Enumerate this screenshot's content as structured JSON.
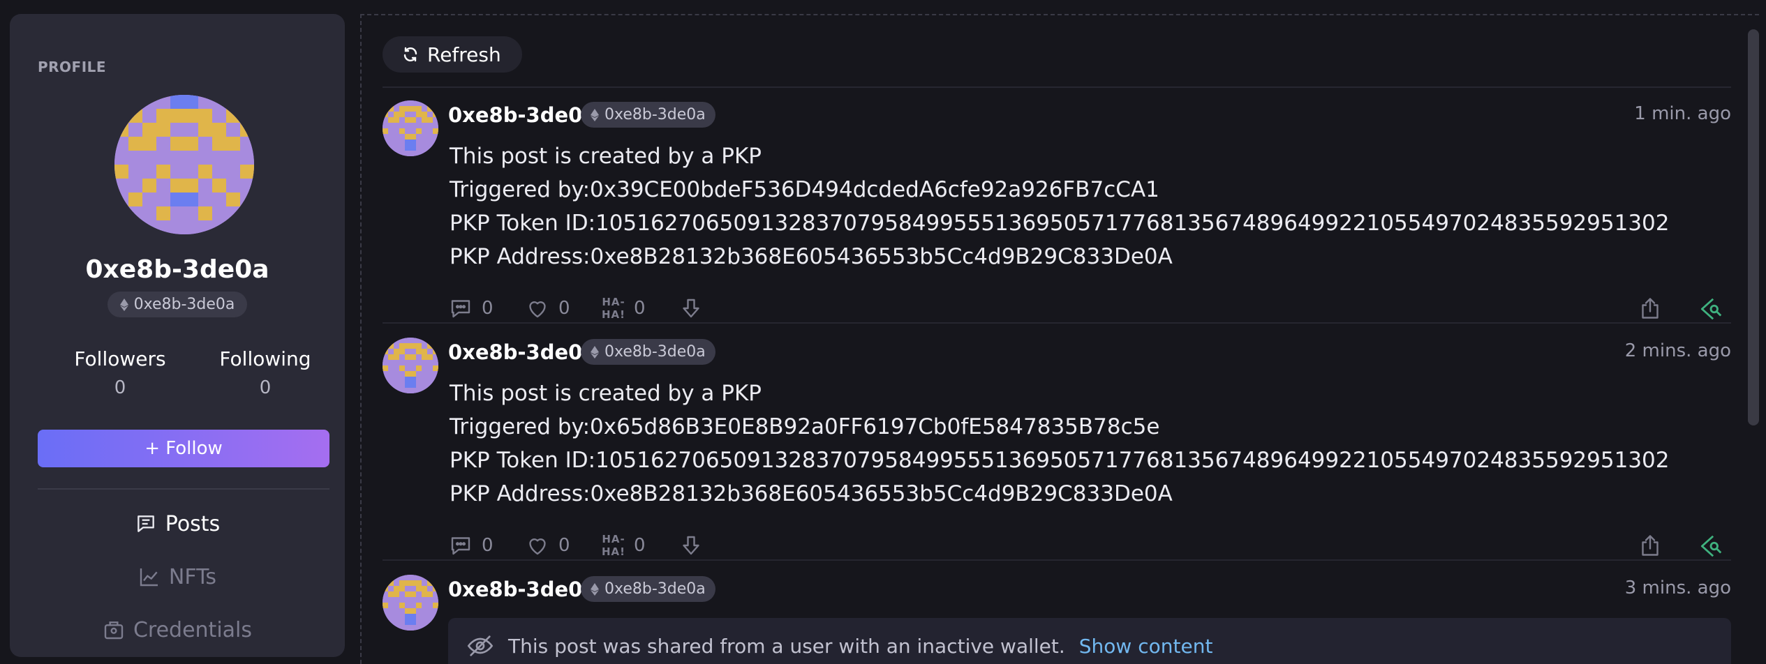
{
  "sidebar": {
    "section_label": "PROFILE",
    "name": "0xe8b-3de0a",
    "address_short": "0xe8b-3de0a",
    "followers_label": "Followers",
    "followers_count": "0",
    "following_label": "Following",
    "following_count": "0",
    "follow_label": "+ Follow",
    "nav": [
      {
        "label": "Posts",
        "icon": "posts-icon",
        "active": true
      },
      {
        "label": "NFTs",
        "icon": "nft-chart-icon",
        "active": false
      },
      {
        "label": "Credentials",
        "icon": "credentials-icon",
        "active": false
      }
    ]
  },
  "main": {
    "refresh_label": "Refresh",
    "posts": [
      {
        "author": "0xe8b-3de0a",
        "address_short": "0xe8b-3de0a",
        "time": "1 min. ago",
        "lines": [
          "This post is created by a PKP",
          "Triggered by:0x39CE00bdeF536D494dcdedA6cfe92a926FB7cCA1",
          "PKP Token ID:105162706509132837079584995551369505717768135674896499221055497024835592951302",
          "PKP Address:0xe8B28132b368E605436553b5Cc4d9B29C833De0A"
        ],
        "comments": "0",
        "likes": "0",
        "haha_top": "HA-",
        "haha_bottom": "HA!",
        "haha_count": "0"
      },
      {
        "author": "0xe8b-3de0a",
        "address_short": "0xe8b-3de0a",
        "time": "2 mins. ago",
        "lines": [
          "This post is created by a PKP",
          "Triggered by:0x65d86B3E0E8B92a0FF6197Cb0fE5847835B78c5e",
          "PKP Token ID:105162706509132837079584995551369505717768135674896499221055497024835592951302",
          "PKP Address:0xe8B28132b368E605436553b5Cc4d9B29C833De0A"
        ],
        "comments": "0",
        "likes": "0",
        "haha_top": "HA-",
        "haha_bottom": "HA!",
        "haha_count": "0"
      },
      {
        "author": "0xe8b-3de0a",
        "address_short": "0xe8b-3de0a",
        "time": "3 mins. ago",
        "hidden_notice": "This post was shared from a user with an inactive wallet.",
        "show_content_label": "Show content"
      }
    ]
  },
  "colors": {
    "background": "#16161c",
    "sidebar": "#2a2a36",
    "follow_gradient_start": "#6a6ef6",
    "follow_gradient_end": "#a56ef0",
    "link": "#72b8f0",
    "lens_green": "#3fb27f",
    "avatar_purple": "#a78bde",
    "avatar_yellow": "#e0b54a",
    "avatar_blue": "#6b7ef0"
  }
}
